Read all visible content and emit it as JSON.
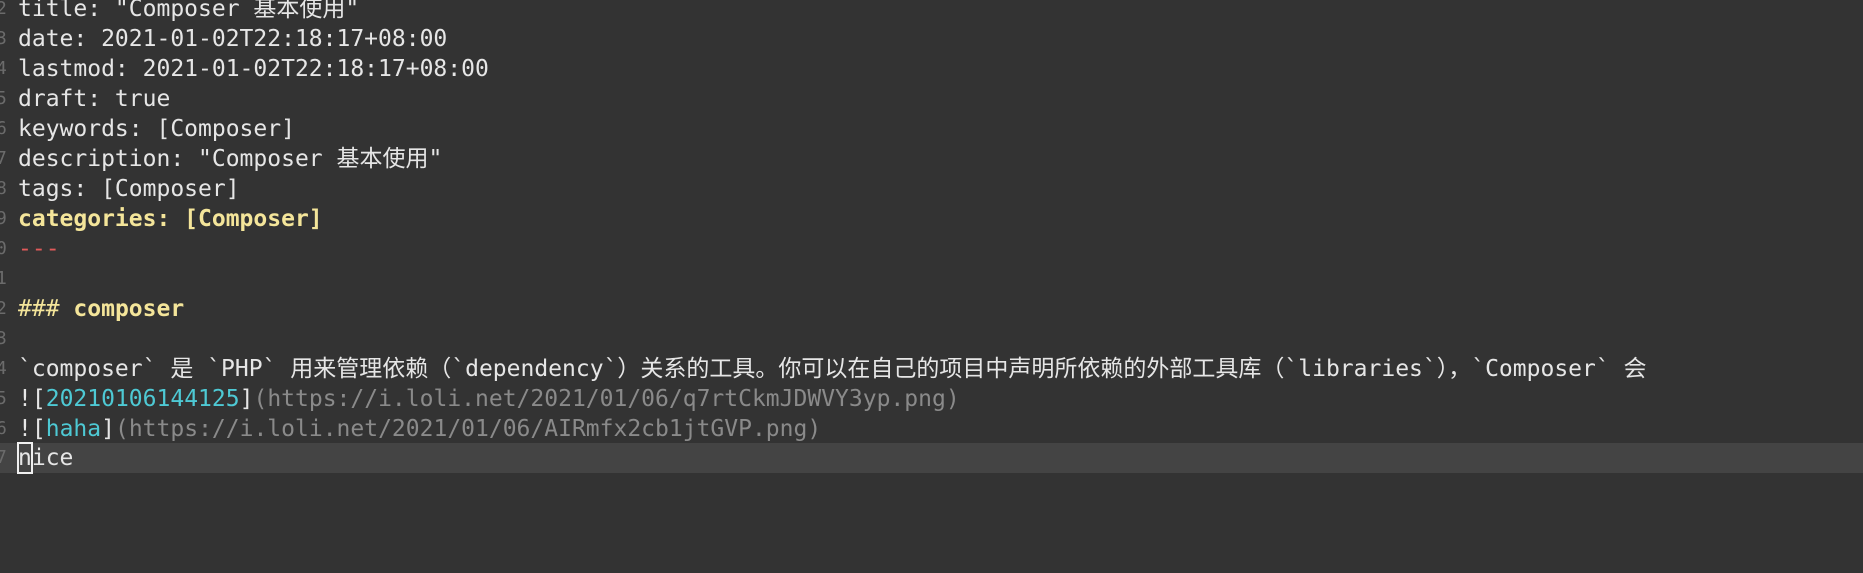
{
  "gutter": [
    "2",
    "3",
    "4",
    "5",
    "6",
    "7",
    "8",
    "9",
    "0",
    "1",
    "2",
    "3",
    "4",
    "5",
    "6",
    "7"
  ],
  "frontmatter": {
    "title_line": "title: \"Composer 基本使用\"",
    "date_line": "date: 2021-01-02T22:18:17+08:00",
    "lastmod_line": "lastmod: 2021-01-02T22:18:17+08:00",
    "draft_line": "draft: true",
    "keywords_line": "keywords: [Composer]",
    "description_line": "description: \"Composer 基本使用\"",
    "tags_line": "tags: [Composer]",
    "categories_line": "categories: [Composer]",
    "separator": "---"
  },
  "heading": {
    "hashes": "###",
    "text": "composer"
  },
  "paragraph": "`composer` 是 `PHP` 用来管理依赖（`dependency`）关系的工具。你可以在自己的项目中声明所依赖的外部工具库（`libraries`），`Composer` 会",
  "images": [
    {
      "bang": "!",
      "open_bracket": "[",
      "alt": "20210106144125",
      "close_bracket": "]",
      "open_paren": "(",
      "url": "https://i.loli.net/2021/01/06/q7rtCkmJDWVY3yp.png",
      "close_paren": ")"
    },
    {
      "bang": "!",
      "open_bracket": "[",
      "alt": "haha",
      "close_bracket": "]",
      "open_paren": "(",
      "url": "https://i.loli.net/2021/01/06/AIRmfx2cb1jtGVP.png",
      "close_paren": ")"
    }
  ],
  "current_line": {
    "cursor_char": "n",
    "rest": "ice"
  },
  "colors": {
    "background": "#333333",
    "current_line": "#444444",
    "yaml_yellow": "#f4e59a",
    "separator_red": "#e05a5a",
    "link_alt_cyan": "#4ec9d4",
    "link_url_gray": "#8a8a8a"
  }
}
